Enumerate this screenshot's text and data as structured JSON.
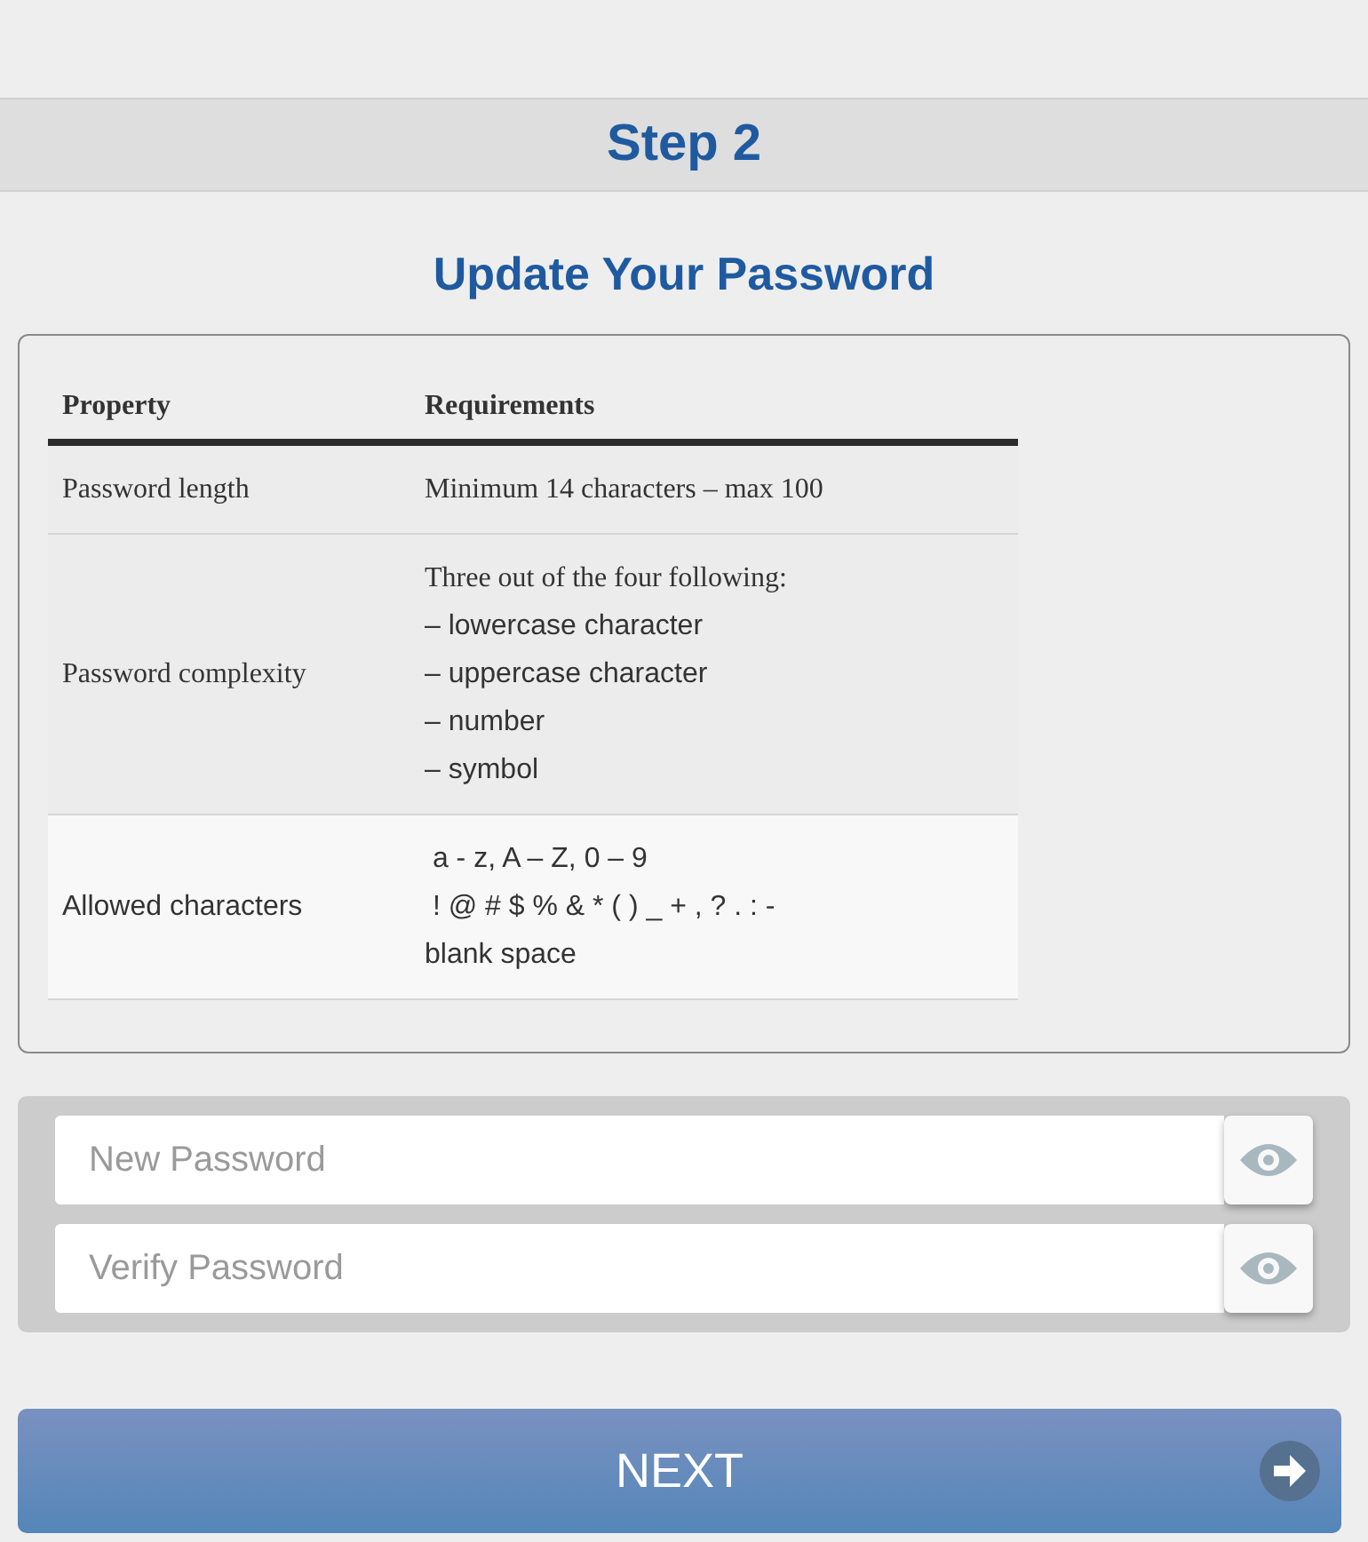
{
  "header": {
    "title": "Step 2"
  },
  "heading": "Update Your Password",
  "table": {
    "columns": [
      "Property",
      "Requirements"
    ],
    "rows": [
      {
        "label": "Password length",
        "kind": "classic",
        "shaded": false,
        "lines": [
          {
            "text": "Minimum 14 characters – max 100",
            "kind": "note"
          }
        ]
      },
      {
        "label": "Password complexity",
        "kind": "classic",
        "shaded": false,
        "lines": [
          {
            "text": "Three out of the four following:",
            "kind": "note"
          },
          {
            "text": "– lowercase character",
            "kind": "item"
          },
          {
            "text": "– uppercase character",
            "kind": "item"
          },
          {
            "text": "– number",
            "kind": "item"
          },
          {
            "text": "– symbol",
            "kind": "item"
          }
        ]
      },
      {
        "label": "Allowed characters",
        "kind": "modern",
        "shaded": true,
        "lines": [
          {
            "text": " a - z, A – Z, 0 – 9",
            "kind": "item"
          },
          {
            "text": " ! @ # $ % & * ( ) _ + , ? . : -",
            "kind": "item"
          },
          {
            "text": "blank space",
            "kind": "item"
          }
        ]
      }
    ]
  },
  "fields": [
    {
      "placeholder": "New Password"
    },
    {
      "placeholder": "Verify Password"
    }
  ],
  "next_button": {
    "label": "NEXT"
  }
}
